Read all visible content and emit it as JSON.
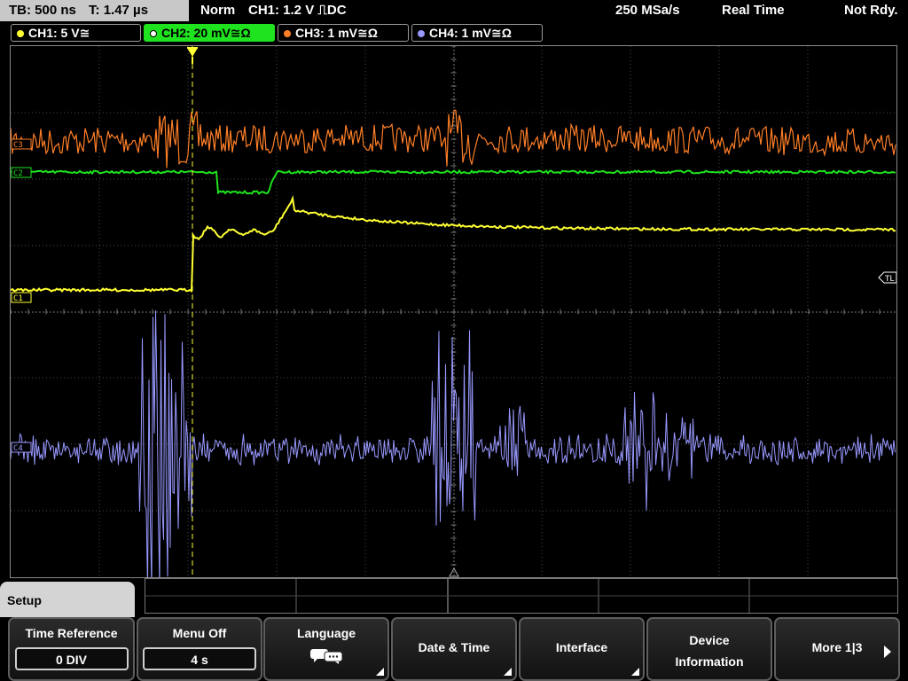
{
  "status_bar": {
    "timebase": "TB: 500 ns",
    "trigger_time": "T: 1.47 µs",
    "mode": "Norm",
    "trigger_info": "CH1: 1.2 V ⎍DC",
    "sample_rate": "250 MSa/s",
    "acq_mode": "Real Time",
    "state": "Not Rdy."
  },
  "channels": [
    {
      "label": "CH1: 5 V≅",
      "color": "#ffff33"
    },
    {
      "label": "CH2: 20 mV≅Ω",
      "color": "#1ee31e"
    },
    {
      "label": "CH3: 1 mV≅Ω",
      "color": "#ff7f27"
    },
    {
      "label": "CH4: 1 mV≅Ω",
      "color": "#9898ff"
    }
  ],
  "markers": {
    "c3": "C3",
    "c2": "C2",
    "c1": "C1",
    "c4": "C4",
    "trigger_level": "TL",
    "trigger_pos": "T"
  },
  "menu": {
    "title": "Setup",
    "softkeys": [
      {
        "label": "Time Reference",
        "value": "0 DIV"
      },
      {
        "label": "Menu Off",
        "value": "4 s"
      },
      {
        "label": "Language",
        "icon": "speech-bubbles-icon"
      },
      {
        "label": "Date & Time"
      },
      {
        "label": "Interface"
      },
      {
        "label": "Device",
        "label2": "Information"
      },
      {
        "label": "More 1|3"
      }
    ]
  }
}
